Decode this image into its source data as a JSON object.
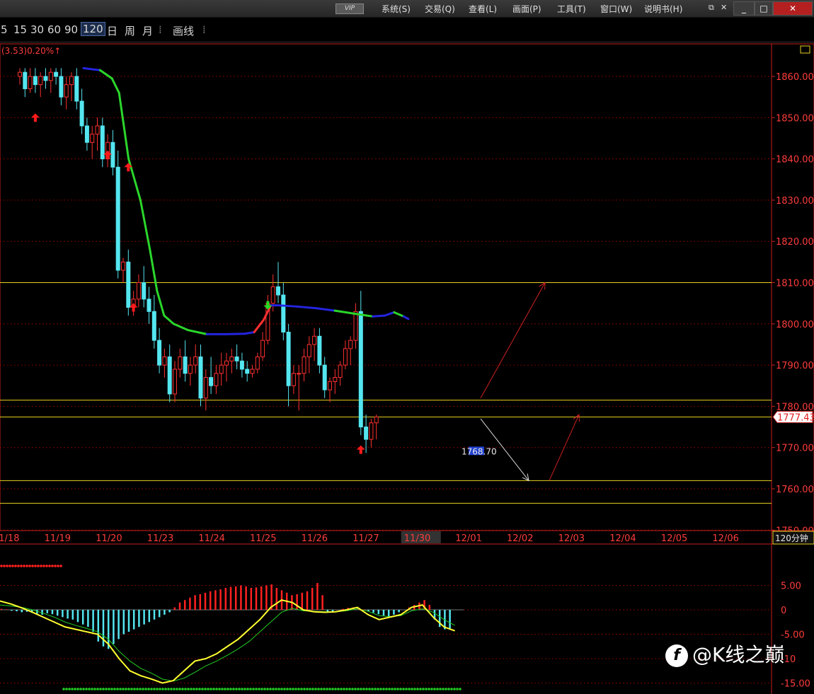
{
  "titlebar": {
    "vip_label": "VIP",
    "menus": [
      "系统(S)",
      "交易(Q)",
      "查看(L)",
      "画面(P)",
      "工具(T)",
      "窗口(W)",
      "说明书(H)"
    ],
    "window_buttons": [
      "_",
      "□",
      "✕"
    ]
  },
  "toolbar": {
    "periods": [
      "5",
      "15",
      "30",
      "60",
      "90",
      "120",
      "日",
      "周",
      "月"
    ],
    "active_period": "120",
    "draw_label": "画线"
  },
  "info": {
    "change_text": "(3.53)0.20%↑"
  },
  "colors": {
    "up": "#ff3030",
    "down": "#54e6f0",
    "ma_down": "#2bd62b",
    "ma_flat": "#2424e0",
    "level_line": "#e8d020",
    "grid": "#7a0000",
    "axis": "#c82020",
    "axis_text": "#ff3c3c"
  },
  "chart_data": {
    "type": "candlestick",
    "period_label": "120分钟",
    "current_price_label": "1777.43",
    "low_marker_label": "1768.70",
    "y_ticks": [
      "1860.00",
      "1850.00",
      "1840.00",
      "1830.00",
      "1820.00",
      "1810.00",
      "1800.00",
      "1790.00",
      "1780.00",
      "1770.00",
      "1760.00",
      "1750.00"
    ],
    "ylim": [
      1748,
      1868
    ],
    "dates": [
      "11/18",
      "11/19",
      "11/20",
      "11/23",
      "11/24",
      "11/25",
      "11/26",
      "11/27",
      "11/30",
      "12/01",
      "12/02",
      "12/03",
      "12/04",
      "12/05",
      "12/06"
    ],
    "levels": [
      1810.0,
      1781.5,
      1777.43,
      1762.0,
      1756.5
    ],
    "candles": [
      [
        1860,
        1862,
        1858,
        1861
      ],
      [
        1861,
        1862,
        1855,
        1857
      ],
      [
        1857,
        1862,
        1856,
        1860
      ],
      [
        1860,
        1862,
        1856,
        1858
      ],
      [
        1858,
        1861,
        1855,
        1860
      ],
      [
        1860,
        1862,
        1857,
        1859
      ],
      [
        1859,
        1862,
        1856,
        1861
      ],
      [
        1861,
        1862,
        1858,
        1860
      ],
      [
        1860,
        1862,
        1853,
        1855
      ],
      [
        1855,
        1860,
        1852,
        1858
      ],
      [
        1858,
        1861,
        1854,
        1860
      ],
      [
        1860,
        1862,
        1852,
        1854
      ],
      [
        1854,
        1857,
        1846,
        1848
      ],
      [
        1848,
        1850,
        1842,
        1844
      ],
      [
        1844,
        1848,
        1840,
        1846
      ],
      [
        1846,
        1850,
        1842,
        1848
      ],
      [
        1848,
        1850,
        1838,
        1840
      ],
      [
        1840,
        1846,
        1838,
        1844
      ],
      [
        1844,
        1847,
        1836,
        1838
      ],
      [
        1838,
        1842,
        1811,
        1813
      ],
      [
        1813,
        1816,
        1810,
        1815
      ],
      [
        1815,
        1818,
        1802,
        1804
      ],
      [
        1804,
        1808,
        1802,
        1806
      ],
      [
        1806,
        1812,
        1804,
        1810
      ],
      [
        1810,
        1814,
        1804,
        1806
      ],
      [
        1806,
        1809,
        1800,
        1803
      ],
      [
        1803,
        1807,
        1794,
        1796
      ],
      [
        1796,
        1799,
        1788,
        1790
      ],
      [
        1790,
        1794,
        1787,
        1792
      ],
      [
        1792,
        1795,
        1781,
        1783
      ],
      [
        1783,
        1791,
        1781,
        1789
      ],
      [
        1789,
        1794,
        1787,
        1792
      ],
      [
        1792,
        1796,
        1786,
        1788
      ],
      [
        1788,
        1792,
        1785,
        1790
      ],
      [
        1790,
        1795,
        1788,
        1792
      ],
      [
        1792,
        1795,
        1780,
        1782
      ],
      [
        1782,
        1789,
        1779,
        1787
      ],
      [
        1787,
        1792,
        1783,
        1785
      ],
      [
        1785,
        1790,
        1783,
        1788
      ],
      [
        1788,
        1793,
        1785,
        1790
      ],
      [
        1790,
        1793,
        1786,
        1791
      ],
      [
        1791,
        1794,
        1788,
        1792
      ],
      [
        1792,
        1795,
        1789,
        1791
      ],
      [
        1791,
        1793,
        1787,
        1789
      ],
      [
        1789,
        1791,
        1786,
        1788
      ],
      [
        1788,
        1790,
        1787,
        1789
      ],
      [
        1789,
        1793,
        1788,
        1792
      ],
      [
        1792,
        1798,
        1791,
        1796
      ],
      [
        1796,
        1807,
        1795,
        1805
      ],
      [
        1805,
        1812,
        1803,
        1809
      ],
      [
        1809,
        1815,
        1805,
        1807
      ],
      [
        1807,
        1810,
        1796,
        1798
      ],
      [
        1798,
        1800,
        1780,
        1785
      ],
      [
        1785,
        1790,
        1783,
        1788
      ],
      [
        1788,
        1790,
        1779,
        1788
      ],
      [
        1788,
        1794,
        1786,
        1792
      ],
      [
        1792,
        1797,
        1788,
        1795
      ],
      [
        1795,
        1799,
        1791,
        1797
      ],
      [
        1797,
        1799,
        1788,
        1790
      ],
      [
        1790,
        1792,
        1782,
        1784
      ],
      [
        1784,
        1787,
        1781,
        1786
      ],
      [
        1786,
        1789,
        1783,
        1787
      ],
      [
        1787,
        1791,
        1785,
        1790
      ],
      [
        1790,
        1796,
        1789,
        1794
      ],
      [
        1794,
        1797,
        1790,
        1796
      ],
      [
        1796,
        1805,
        1794,
        1803
      ],
      [
        1803,
        1808,
        1773,
        1775
      ],
      [
        1775,
        1778,
        1768.7,
        1772
      ],
      [
        1772,
        1777,
        1770,
        1776
      ],
      [
        1776,
        1778,
        1772,
        1777.43
      ]
    ],
    "ma_line": [
      [
        28,
        1862
      ],
      [
        35,
        1861.5
      ],
      [
        40,
        1859.5
      ],
      [
        43,
        1856
      ],
      [
        45,
        1848
      ],
      [
        47,
        1840
      ],
      [
        52,
        1830
      ],
      [
        56,
        1818
      ],
      [
        59,
        1808
      ],
      [
        62,
        1802
      ],
      [
        66,
        1800
      ],
      [
        72,
        1798.5
      ],
      [
        80,
        1797.5
      ],
      [
        88,
        1797.5
      ],
      [
        96,
        1797.6
      ],
      [
        100,
        1798
      ],
      [
        104,
        1801
      ],
      [
        107,
        1804.5
      ],
      [
        110,
        1804.5
      ],
      [
        118,
        1804.2
      ],
      [
        126,
        1803.8
      ],
      [
        134,
        1803.2
      ],
      [
        142,
        1802.5
      ],
      [
        150,
        1801.8
      ],
      [
        155,
        1802
      ],
      [
        159,
        1802.8
      ],
      [
        163,
        1801.8
      ],
      [
        165,
        1801.2
      ]
    ],
    "arrows_up": [
      [
        3,
        1850
      ],
      [
        17,
        1841
      ],
      [
        21,
        1838
      ],
      [
        22,
        1804
      ],
      [
        66,
        1769.5
      ]
    ],
    "arrows_down": [
      [
        48,
        1804.5
      ]
    ],
    "projections": [
      {
        "from": [
          1782,
          1
        ],
        "to": [
          1810,
          1
        ],
        "dx": [
          679,
          770
        ]
      },
      {
        "from": [
          1777,
          0
        ],
        "to": [
          1762,
          0
        ],
        "dx": [
          679,
          747
        ]
      },
      {
        "from": [
          1762,
          1
        ],
        "to": [
          1778,
          1
        ],
        "dx": [
          776,
          818
        ]
      }
    ],
    "macd": {
      "y_ticks": [
        "5.00",
        "0",
        "-5.00",
        "-10",
        "-15.00"
      ],
      "ylim": [
        -16.5,
        8
      ],
      "hist": [
        0.2,
        0.1,
        -0.2,
        -0.3,
        -0.5,
        -0.4,
        -0.6,
        -0.8,
        -1.0,
        -0.7,
        -0.9,
        -1.2,
        -1.5,
        -1.8,
        -2.0,
        -2.5,
        -3.0,
        -3.5,
        -4.5,
        -6.5,
        -7.5,
        -8.0,
        -7.0,
        -6.0,
        -5.0,
        -4.5,
        -4.0,
        -3.5,
        -3.0,
        -2.5,
        -2.0,
        -1.5,
        -1.0,
        -0.5,
        0.5,
        1.5,
        2.0,
        2.5,
        3.0,
        3.2,
        3.5,
        3.8,
        4.0,
        4.2,
        4.5,
        4.7,
        4.8,
        5.0,
        4.8,
        4.5,
        4.6,
        4.8,
        5.0,
        5.2,
        4.5,
        4.0,
        3.5,
        3.0,
        3.2,
        3.5,
        3.8,
        4.5,
        5.5,
        3.0,
        -0.5,
        -0.3,
        0.0,
        0.2,
        0.4,
        0.5,
        0.3,
        0.1,
        -0.3,
        -0.6,
        -0.9,
        -1.2,
        -1.5,
        -1.0,
        -0.5,
        0.0,
        0.5,
        1.0,
        1.5,
        2.0,
        1.0,
        -2.0,
        -3.5,
        -4.0,
        -3.8
      ],
      "dif": [
        1.8,
        1.2,
        0.4,
        -0.5,
        -1.5,
        -2.5,
        -3.5,
        -4.0,
        -4.5,
        -5.0,
        -7.0,
        -10.0,
        -12.5,
        -13.5,
        -14.2,
        -15.0,
        -14.5,
        -12.5,
        -10.5,
        -10.0,
        -9.0,
        -7.5,
        -6.0,
        -4.0,
        -2.0,
        0.5,
        2.0,
        1.5,
        0.0,
        -0.4,
        -0.5,
        -0.4,
        0.0,
        0.5,
        -1.0,
        -2.0,
        -1.5,
        -1.0,
        0.5,
        1.0,
        -1.5,
        -3.5,
        -4.3
      ],
      "dea": [
        1.0,
        0.8,
        0.5,
        0.0,
        -0.7,
        -1.5,
        -2.5,
        -3.2,
        -3.8,
        -4.5,
        -6.0,
        -8.5,
        -10.5,
        -12.0,
        -13.0,
        -14.2,
        -14.6,
        -14.0,
        -12.8,
        -11.5,
        -10.5,
        -9.3,
        -8.0,
        -6.5,
        -4.5,
        -2.5,
        -0.5,
        0.3,
        -0.2,
        -0.3,
        -0.4,
        -0.4,
        -0.2,
        0.2,
        -0.3,
        -1.2,
        -1.4,
        -1.2,
        -0.2,
        0.2,
        -0.5,
        -2.0,
        -3.2
      ]
    }
  },
  "watermark": {
    "logo_glyph": "f",
    "text": "@K线之巅"
  }
}
